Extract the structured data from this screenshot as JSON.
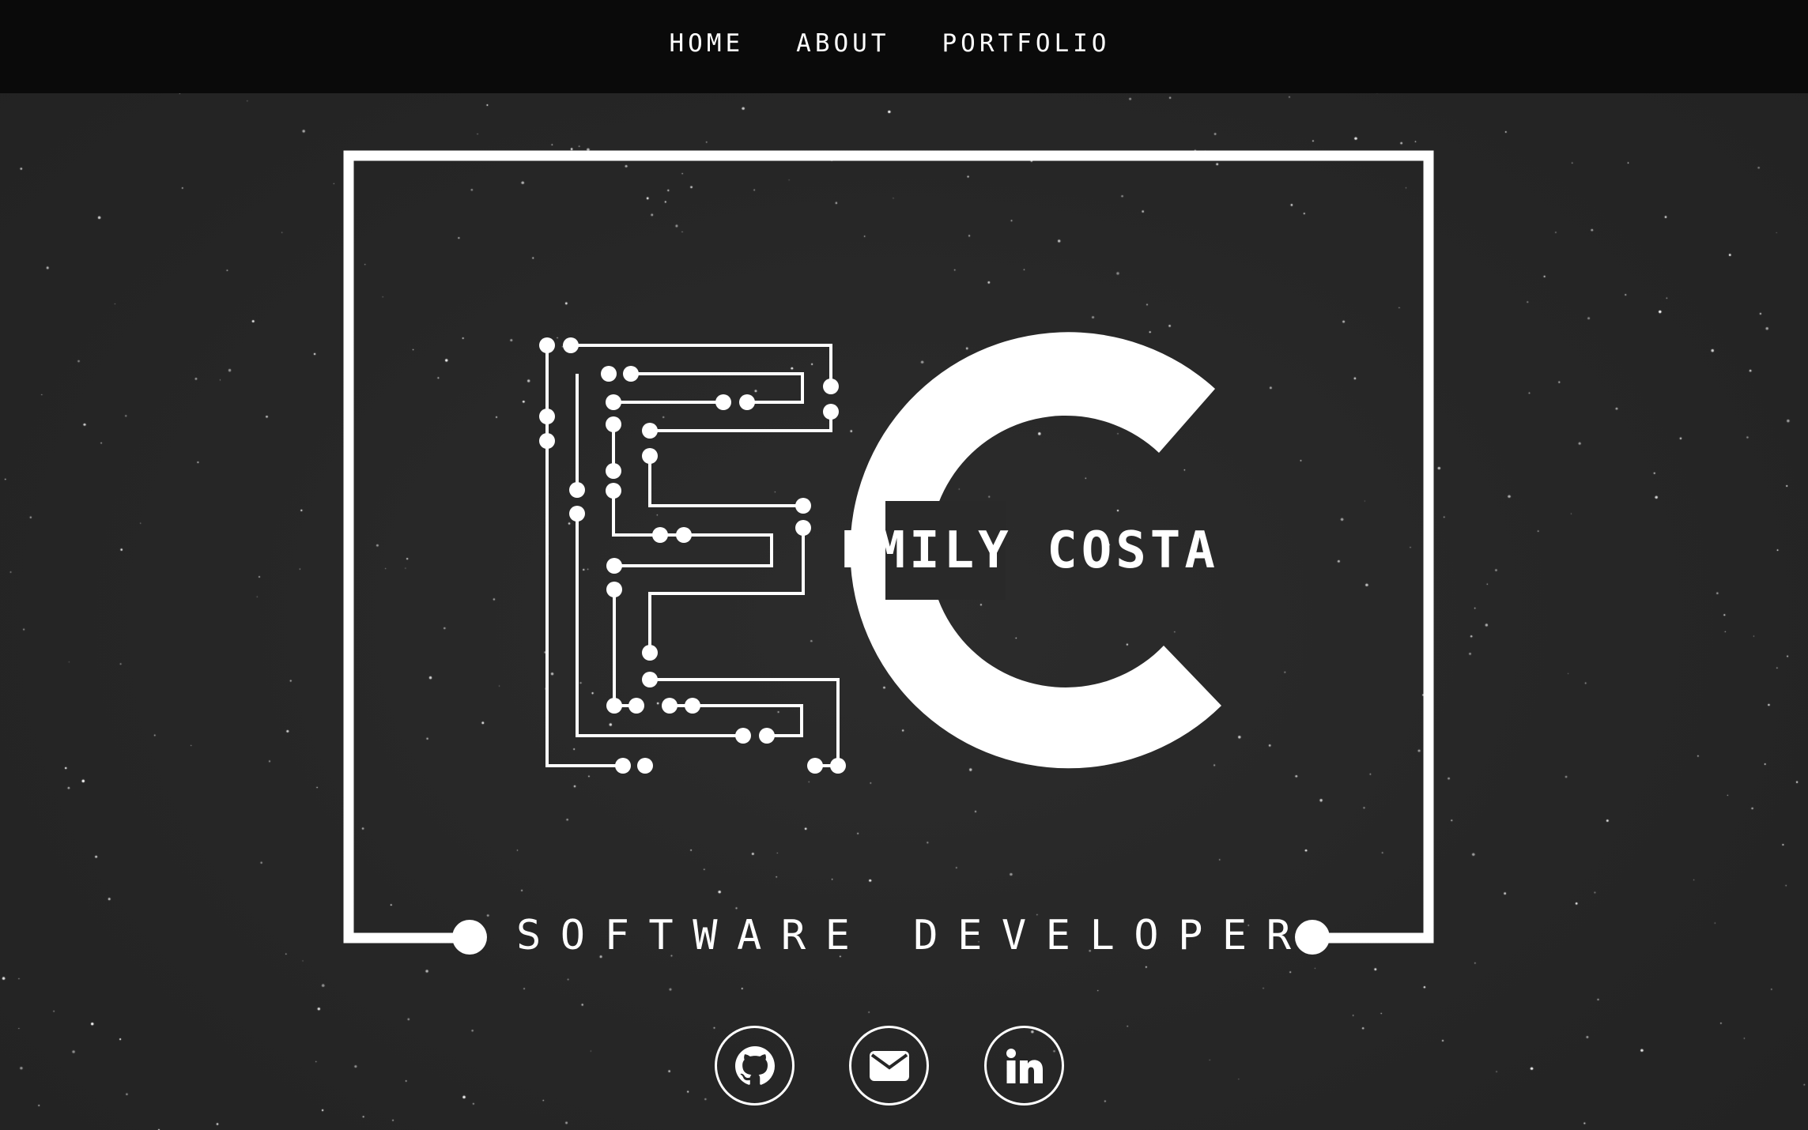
{
  "nav": {
    "items": [
      {
        "label": "HOME"
      },
      {
        "label": "ABOUT"
      },
      {
        "label": "PORTFOLIO"
      }
    ]
  },
  "hero": {
    "monogram": "EC",
    "name": "EMILY COSTA",
    "tagline": "SOFTWARE DEVELOPER"
  },
  "social": [
    {
      "icon": "github-icon"
    },
    {
      "icon": "envelope-icon"
    },
    {
      "icon": "linkedin-icon"
    }
  ],
  "colors": {
    "background": "#262626",
    "navbar": "#0a0a0a",
    "foreground": "#ffffff"
  }
}
